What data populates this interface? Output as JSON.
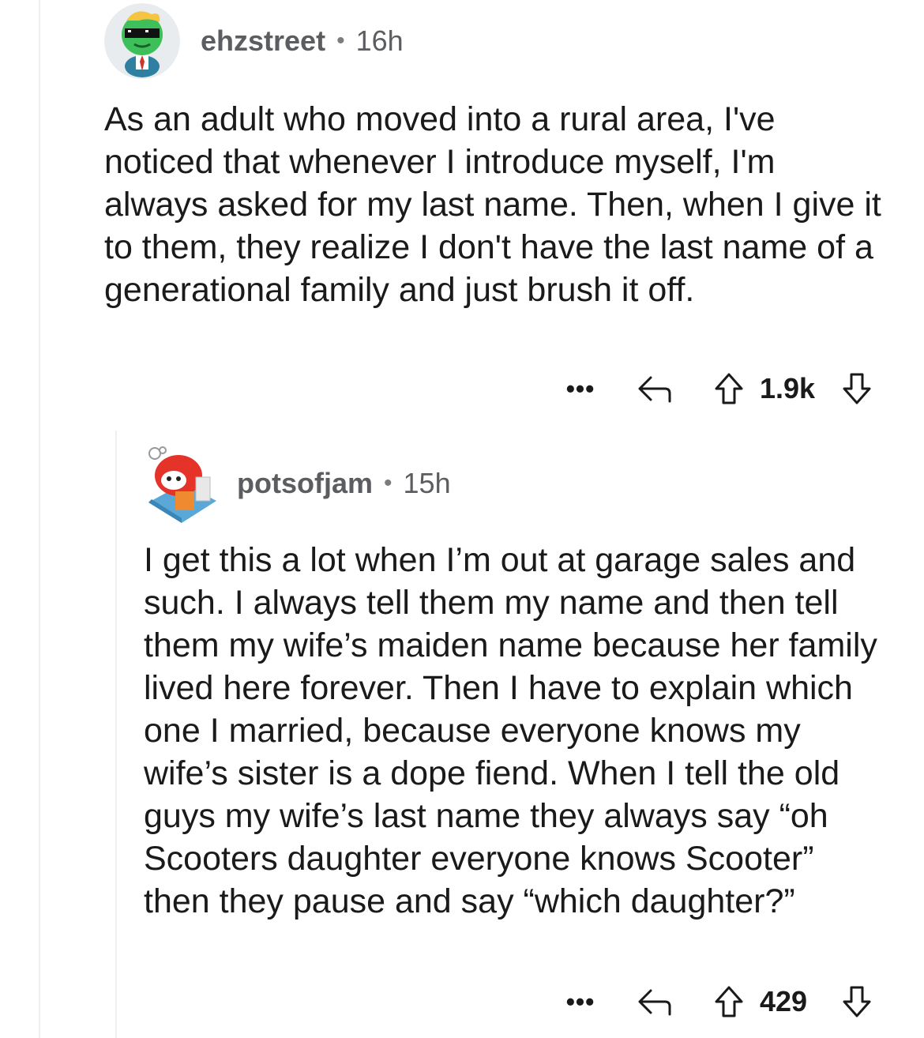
{
  "comments": [
    {
      "username": "ehzstreet",
      "separator": "•",
      "time": "16h",
      "body": "As an adult who moved into a rural area, I've noticed that whenever I introduce myself, I'm always asked for my last name. Then, when I give it to them, they realize I don't have the last name of a generational family and just brush it off.",
      "more": "•••",
      "score": "1.9k"
    },
    {
      "username": "potsofjam",
      "separator": "•",
      "time": "15h",
      "body": "I get this a lot when I’m out at garage sales and such. I always tell them my name and then tell them my wife’s maiden name because her family lived here forever. Then I have to explain which one I married, because everyone knows my wife’s sister is a dope fiend. When I tell the old guys my wife’s last name they always say “oh Scooters daughter everyone knows Scooter” then they pause and say “which daughter?”",
      "more": "•••",
      "score": "429"
    }
  ],
  "icons": {
    "more": "ellipsis-icon",
    "reply": "reply-arrow-icon",
    "upvote": "upvote-arrow-icon",
    "downvote": "downvote-arrow-icon"
  },
  "colors": {
    "text": "#1a1a1b",
    "meta": "#5b5d60",
    "thread_line": "#edeff1"
  }
}
